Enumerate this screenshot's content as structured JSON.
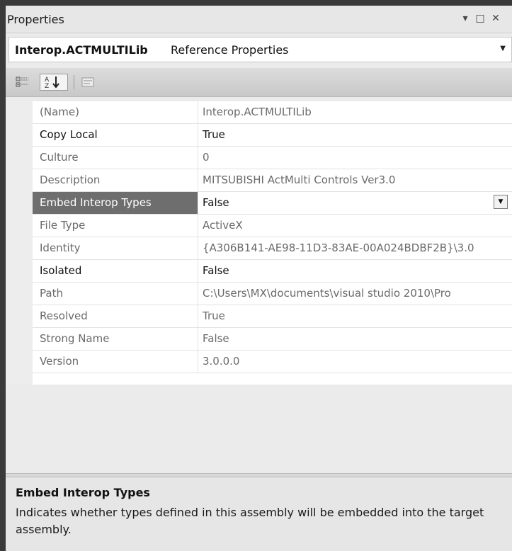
{
  "window": {
    "title": "Properties",
    "buttons": {
      "dropdown": "▾",
      "maximize": "□",
      "close": "✕"
    }
  },
  "selector": {
    "object_name": "Interop.ACTMULTILib",
    "object_type": "Reference Properties",
    "arrow": "▼"
  },
  "toolbar": {
    "categorized_icon": "categorized-icon",
    "alphabetical_icon": "alphabetical-icon",
    "property_pages_icon": "property-pages-icon"
  },
  "properties": [
    {
      "name": "(Name)",
      "value": "Interop.ACTMULTILib"
    },
    {
      "name": "Copy Local",
      "value": "True"
    },
    {
      "name": "Culture",
      "value": "0"
    },
    {
      "name": "Description",
      "value": "MITSUBISHI ActMulti Controls Ver3.0"
    },
    {
      "name": "Embed Interop Types",
      "value": "False"
    },
    {
      "name": "File Type",
      "value": "ActiveX"
    },
    {
      "name": "Identity",
      "value": "{A306B141-AE98-11D3-83AE-00A024BDBF2B}\\3.0"
    },
    {
      "name": "Isolated",
      "value": "False"
    },
    {
      "name": "Path",
      "value": "C:\\Users\\MX\\documents\\visual studio 2010\\Pro"
    },
    {
      "name": "Resolved",
      "value": "True"
    },
    {
      "name": "Strong Name",
      "value": "False"
    },
    {
      "name": "Version",
      "value": "3.0.0.0"
    }
  ],
  "dropdown_arrow": "▼",
  "description": {
    "title": "Embed Interop Types",
    "text": "Indicates whether types defined in this assembly will be embedded into the target assembly."
  },
  "colors": {
    "selected_row": "#6e6e6e",
    "panel_bg": "#ebebeb"
  }
}
